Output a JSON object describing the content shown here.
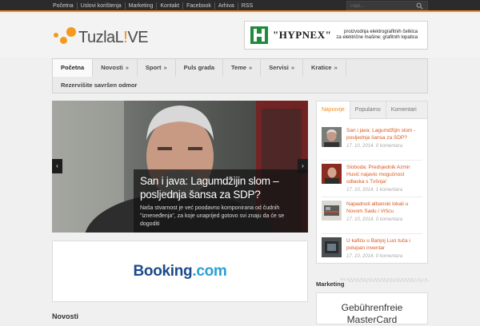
{
  "topbar": {
    "links": [
      "Početna",
      "Uslovi korištenja",
      "Marketing",
      "Kontakt",
      "Facebook",
      "Arhiva",
      "RSS"
    ],
    "search_placeholder": "Traži..."
  },
  "logo": {
    "part1": "TuzlaL",
    "accent": "!",
    "part2": "VE"
  },
  "banner": {
    "brand": "\"HYPNEX\"",
    "desc_line1": "proizvodnja elektrografitnih četkica",
    "desc_line2": "za električne mašine; grafitnih lopatica"
  },
  "nav": {
    "row1": [
      {
        "label": "Početna",
        "arrow": ""
      },
      {
        "label": "Novosti",
        "arrow": "»"
      },
      {
        "label": "Sport",
        "arrow": "»"
      },
      {
        "label": "Puls grada",
        "arrow": ""
      },
      {
        "label": "Teme",
        "arrow": "»"
      },
      {
        "label": "Servisi",
        "arrow": "»"
      },
      {
        "label": "Kratice",
        "arrow": "»"
      }
    ],
    "row2": [
      {
        "label": "Rezervišite savršen odmor",
        "arrow": ""
      }
    ]
  },
  "slider": {
    "title": "San i java: Lagumdžijin slom – posljednja šansa za SDP?",
    "excerpt": "Naša stvarnost je već poodavno komponirana od čudnih \"izneneđenja\", za koje unaprijed gotovo svi znaju da će se dogoditi",
    "prev": "‹",
    "next": "›"
  },
  "booking": {
    "part1": "Booking",
    "part2": ".com"
  },
  "section": {
    "novosti": "Novosti"
  },
  "sidebar": {
    "tabs": [
      "Najnovije",
      "Popularno",
      "Komentari"
    ],
    "posts": [
      {
        "title": "San i java: Lagumdžijin slom - posljednja šansa za SDP?",
        "meta": "17. 10, 2014. 0 komentara"
      },
      {
        "title": "Sloboda: Predsjednik Azmir Husić najavio mogućnost odlaska s Tvšnja!",
        "meta": "17. 10, 2014. 1 komentara"
      },
      {
        "title": "Napadnuti albanski lokali u Novom Sadu i Vršcu",
        "meta": "17. 10, 2014. 0 komentara"
      },
      {
        "title": "U kafiću u Banjoj Luci tuča i polupan inventar",
        "meta": "17. 10, 2014. 0 komentara"
      }
    ],
    "marketing_label": "Marketing",
    "ad_line1": "Gebührenfreie",
    "ad_line2": "MasterCard"
  },
  "colors": {
    "accent": "#f28c1e",
    "link": "#d9571e",
    "booking_dark": "#1b4a8a",
    "booking_light": "#2a9fd6"
  }
}
